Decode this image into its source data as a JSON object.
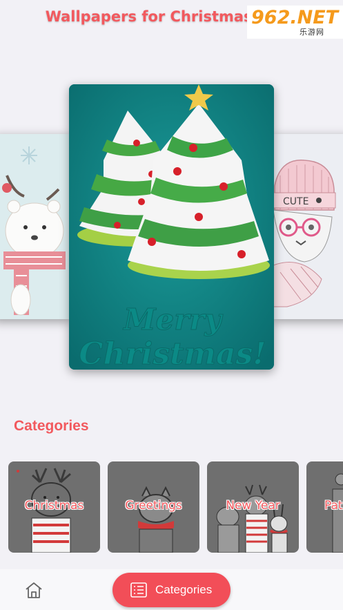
{
  "header": {
    "title": "Wallpapers for Christmas 2022"
  },
  "wallpaper_text": {
    "line1": "Merry",
    "line2": "Christmas!",
    "hat_text": "CUTE"
  },
  "categories": {
    "title": "Categories",
    "items": [
      {
        "label": "Christmas"
      },
      {
        "label": "Greetings"
      },
      {
        "label": "New Year"
      },
      {
        "label": "Pat"
      }
    ]
  },
  "tabbar": {
    "home_icon": "home-icon",
    "categories_label": "Categories",
    "categories_icon": "list-icon"
  },
  "watermark": {
    "main": "962.NET",
    "sub": "乐游网"
  },
  "colors": {
    "accent": "#f2595e",
    "tab_active": "#f24e58",
    "center_bg": "#0d7f7f"
  }
}
